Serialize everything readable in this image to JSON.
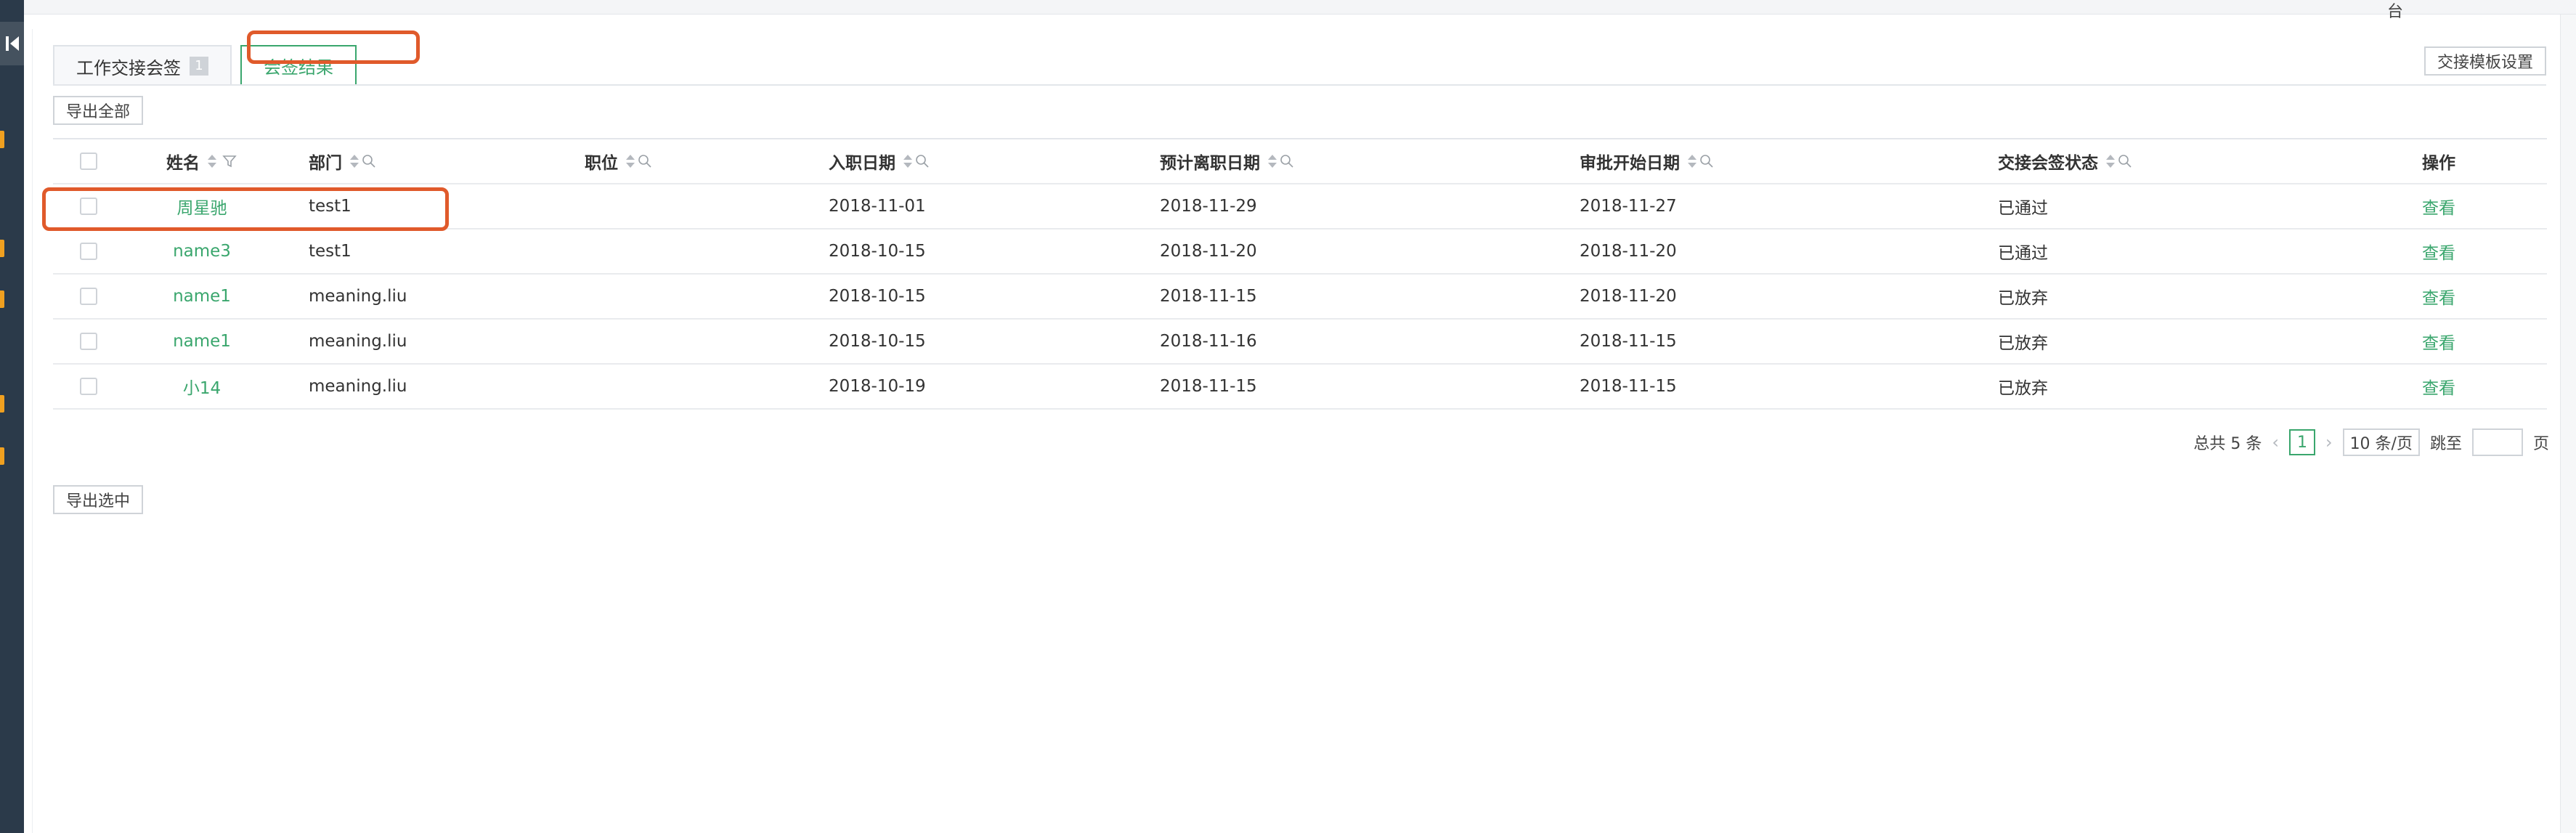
{
  "top_strip": {
    "text": "台"
  },
  "tabs": [
    {
      "label": "工作交接会签",
      "badge": "1"
    },
    {
      "label": "会签结果"
    }
  ],
  "toolbar": {
    "template_settings": "交接模板设置",
    "export_all": "导出全部",
    "export_selected": "导出选中"
  },
  "table": {
    "columns": {
      "name": "姓名",
      "dept": "部门",
      "position": "职位",
      "entry_date": "入职日期",
      "leave_date": "预计离职日期",
      "approve_date": "审批开始日期",
      "status": "交接会签状态",
      "operation": "操作"
    },
    "rows": [
      {
        "name": "周星驰",
        "dept": "test1",
        "position": "",
        "entry_date": "2018-11-01",
        "leave_date": "2018-11-29",
        "approve_date": "2018-11-27",
        "status": "已通过",
        "op": "查看"
      },
      {
        "name": "name3",
        "dept": "test1",
        "position": "",
        "entry_date": "2018-10-15",
        "leave_date": "2018-11-20",
        "approve_date": "2018-11-20",
        "status": "已通过",
        "op": "查看"
      },
      {
        "name": "name1",
        "dept": "meaning.liu",
        "position": "",
        "entry_date": "2018-10-15",
        "leave_date": "2018-11-15",
        "approve_date": "2018-11-20",
        "status": "已放弃",
        "op": "查看"
      },
      {
        "name": "name1",
        "dept": "meaning.liu",
        "position": "",
        "entry_date": "2018-10-15",
        "leave_date": "2018-11-16",
        "approve_date": "2018-11-15",
        "status": "已放弃",
        "op": "查看"
      },
      {
        "name": "小14",
        "dept": "meaning.liu",
        "position": "",
        "entry_date": "2018-10-19",
        "leave_date": "2018-11-15",
        "approve_date": "2018-11-15",
        "status": "已放弃",
        "op": "查看"
      }
    ]
  },
  "pagination": {
    "total": "总共 5 条",
    "current_page": "1",
    "page_size": "10 条/页",
    "jump_label": "跳至",
    "page_suffix": "页"
  },
  "colors": {
    "accent": "#3aa66d",
    "annotation": "#e05a2b",
    "rail": "#2b3a4a",
    "rail_mark": "#f0a020"
  }
}
